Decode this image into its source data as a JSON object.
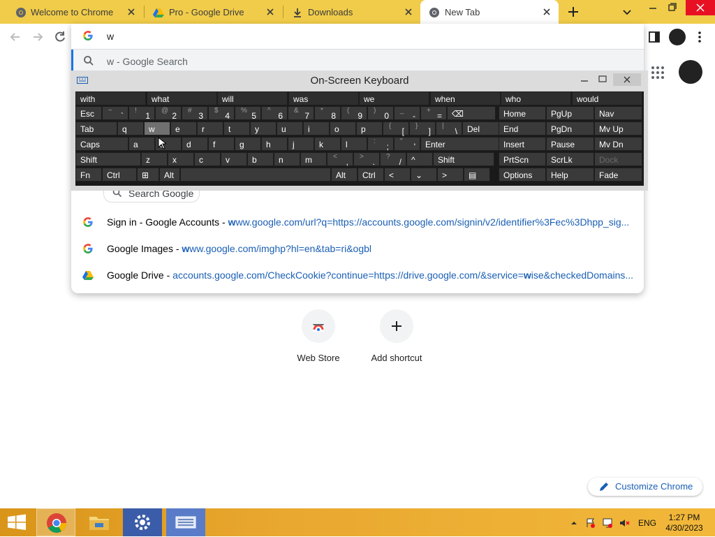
{
  "tabs": [
    {
      "title": "Welcome to Chrome",
      "icon": "chrome-icon",
      "active": false
    },
    {
      "title": "Pro - Google Drive",
      "icon": "google-drive-icon",
      "active": false
    },
    {
      "title": "Downloads",
      "icon": "download-icon",
      "active": false
    },
    {
      "title": "New Tab",
      "icon": "chrome-icon",
      "active": true
    }
  ],
  "omnibox": {
    "text": "w",
    "active_suggestion": "w - Google Search",
    "suggestions": [
      {
        "title": "Sign in - Google Accounts",
        "sep": " - ",
        "url_bold": "w",
        "url_rest": "ww.google.com/url?q=https://accounts.google.com/signin/v2/identifier%3Fec%3Dhpp_sig...",
        "icon": "google-g-icon"
      },
      {
        "title": "Google Images",
        "sep": " - ",
        "url_bold": "w",
        "url_rest": "ww.google.com/imghp?hl=en&tab=ri&ogbl",
        "icon": "google-g-icon"
      },
      {
        "title": "Google Drive",
        "sep": " - ",
        "url_pre": "accounts.google.com/CheckCookie?continue=https://drive.google.com/&service=",
        "url_bold": "w",
        "url_rest": "ise&checkedDomains...",
        "icon": "google-drive-icon"
      }
    ]
  },
  "search_chip": "Search Google",
  "osk": {
    "title": "On-Screen Keyboard",
    "predictions": [
      "with",
      "what",
      "will",
      "was",
      "we",
      "when",
      "who",
      "would"
    ],
    "rows": [
      [
        [
          "Esc",
          ""
        ],
        [
          "`",
          "~"
        ],
        [
          "1",
          "!"
        ],
        [
          "2",
          "@"
        ],
        [
          "3",
          "#"
        ],
        [
          "4",
          "$"
        ],
        [
          "5",
          "%"
        ],
        [
          "6",
          "^"
        ],
        [
          "7",
          "&"
        ],
        [
          "8",
          "*"
        ],
        [
          "9",
          "("
        ],
        [
          "0",
          ")"
        ],
        [
          "-",
          "_"
        ],
        [
          "=",
          "+"
        ],
        [
          "⌫",
          ""
        ]
      ],
      [
        [
          "Tab",
          ""
        ],
        [
          "q",
          ""
        ],
        [
          "w",
          ""
        ],
        [
          "e",
          ""
        ],
        [
          "r",
          ""
        ],
        [
          "t",
          ""
        ],
        [
          "y",
          ""
        ],
        [
          "u",
          ""
        ],
        [
          "i",
          ""
        ],
        [
          "o",
          ""
        ],
        [
          "p",
          ""
        ],
        [
          "[",
          "{"
        ],
        [
          "]",
          "}"
        ],
        [
          "\\",
          "|"
        ],
        [
          "Del",
          ""
        ]
      ],
      [
        [
          "Caps",
          ""
        ],
        [
          "a",
          ""
        ],
        [
          "s",
          ""
        ],
        [
          "d",
          ""
        ],
        [
          "f",
          ""
        ],
        [
          "g",
          ""
        ],
        [
          "h",
          ""
        ],
        [
          "j",
          ""
        ],
        [
          "k",
          ""
        ],
        [
          "l",
          ""
        ],
        [
          ";",
          ":"
        ],
        [
          "'",
          "\""
        ],
        [
          "Enter",
          ""
        ]
      ],
      [
        [
          "Shift",
          ""
        ],
        [
          "z",
          ""
        ],
        [
          "x",
          ""
        ],
        [
          "c",
          ""
        ],
        [
          "v",
          ""
        ],
        [
          "b",
          ""
        ],
        [
          "n",
          ""
        ],
        [
          "m",
          ""
        ],
        [
          ",",
          "<"
        ],
        [
          ".",
          ">"
        ],
        [
          "/",
          "?"
        ],
        [
          "^",
          ""
        ],
        [
          "Shift",
          ""
        ]
      ],
      [
        [
          "Fn",
          ""
        ],
        [
          "Ctrl",
          ""
        ],
        [
          "⊞",
          ""
        ],
        [
          "Alt",
          ""
        ],
        [
          "",
          ""
        ],
        [
          "Alt",
          ""
        ],
        [
          "Ctrl",
          ""
        ],
        [
          "<",
          ""
        ],
        [
          "⌄",
          ""
        ],
        [
          ">",
          ""
        ],
        [
          "▤",
          ""
        ]
      ]
    ],
    "nav_keys": [
      [
        "Home",
        "PgUp",
        "Nav"
      ],
      [
        "End",
        "PgDn",
        "Mv Up"
      ],
      [
        "Insert",
        "Pause",
        "Mv Dn"
      ],
      [
        "PrtScn",
        "ScrLk",
        "Dock"
      ],
      [
        "Options",
        "Help",
        "Fade"
      ]
    ]
  },
  "shortcuts": [
    {
      "label": "Web Store",
      "icon": "web-store-icon"
    },
    {
      "label": "Add shortcut",
      "icon": "plus-icon"
    }
  ],
  "customize_label": "Customize Chrome",
  "taskbar": {
    "apps": [
      "chrome-icon",
      "file-explorer-icon",
      "control-panel-icon",
      "on-screen-keyboard-icon"
    ],
    "lang": "ENG",
    "time": "1:27 PM",
    "date": "4/30/2023"
  }
}
